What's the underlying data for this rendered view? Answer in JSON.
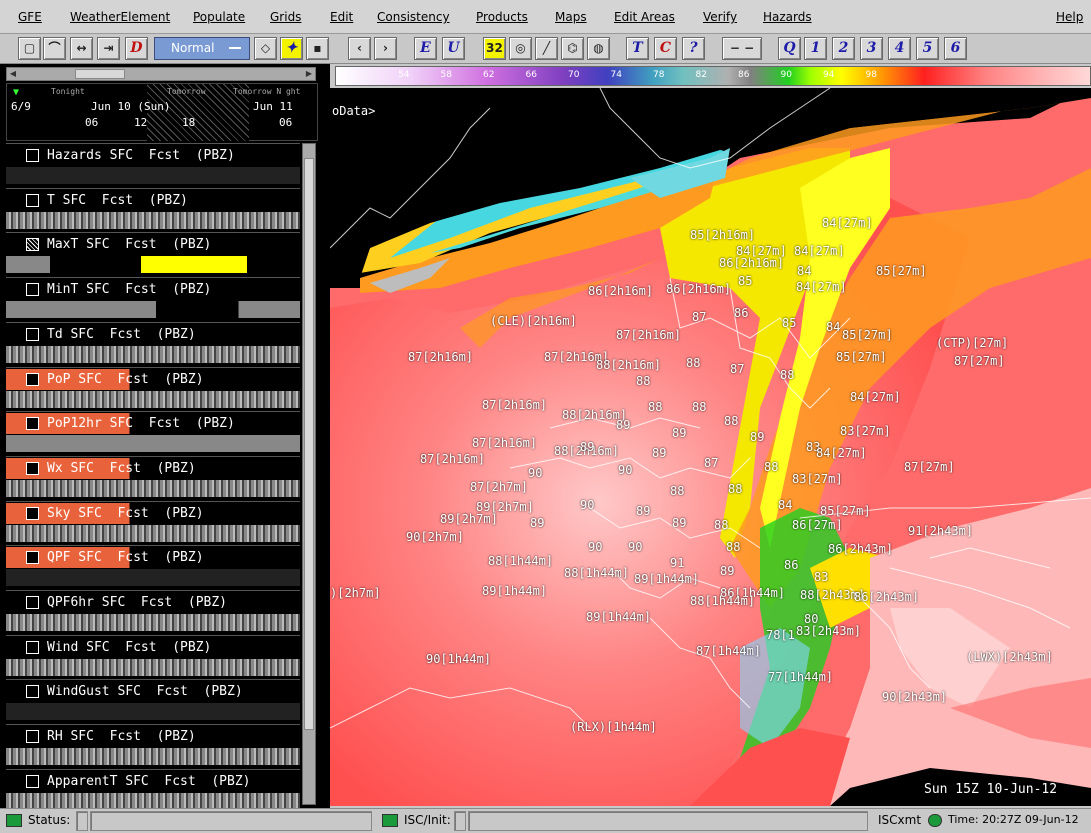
{
  "menu": [
    "GFE",
    "WeatherElement",
    "Populate",
    "Grids",
    "Edit",
    "Consistency",
    "Products",
    "Maps",
    "Edit Areas",
    "Verify",
    "Hazards"
  ],
  "help": "Help",
  "toolbar": {
    "mode": "Normal",
    "buttons": [
      "D",
      "E",
      "U",
      "T",
      "C",
      "?",
      "Q",
      "1",
      "2",
      "3",
      "4",
      "5",
      "6"
    ],
    "badge": "32"
  },
  "timeline": {
    "date": "6/9",
    "labels": [
      "Tonight",
      "Tomorrow",
      "Tomorrow N ght"
    ],
    "days": [
      "Jun 10 (Sun)",
      "Jun 11"
    ],
    "hours": [
      "06",
      "12",
      "18",
      "06"
    ]
  },
  "grids": [
    {
      "label": "Hazards SFC  Fcst  (PBZ)",
      "hl": false
    },
    {
      "label": "T SFC  Fcst  (PBZ)",
      "hl": false
    },
    {
      "label": "MaxT SFC  Fcst  (PBZ)",
      "hl": false,
      "hatch": true
    },
    {
      "label": "MinT SFC  Fcst  (PBZ)",
      "hl": false
    },
    {
      "label": "Td SFC  Fcst  (PBZ)",
      "hl": false
    },
    {
      "label": "PoP SFC  Fcst  (PBZ)",
      "hl": true
    },
    {
      "label": "PoP12hr SFC  Fcst  (PBZ)",
      "hl": true
    },
    {
      "label": "Wx SFC  Fcst  (PBZ)",
      "hl": true
    },
    {
      "label": "Sky SFC  Fcst  (PBZ)",
      "hl": true
    },
    {
      "label": "QPF SFC  Fcst  (PBZ)",
      "hl": true
    },
    {
      "label": "QPF6hr SFC  Fcst  (PBZ)",
      "hl": false
    },
    {
      "label": "Wind SFC  Fcst  (PBZ)",
      "hl": false
    },
    {
      "label": "WindGust SFC  Fcst  (PBZ)",
      "hl": false
    },
    {
      "label": "RH SFC  Fcst  (PBZ)",
      "hl": false
    },
    {
      "label": "ApparentT SFC  Fcst  (PBZ)",
      "hl": false
    }
  ],
  "colorbar": {
    "ticks": [
      "54",
      "58",
      "62",
      "66",
      "70",
      "74",
      "78",
      "82",
      "86",
      "90",
      "94",
      "98"
    ]
  },
  "map": {
    "nodata": "oData>",
    "timestamp": "Sun 15Z 10-Jun-12",
    "labels": [
      [
        "84[27m]",
        492,
        128
      ],
      [
        "85[2h16m]",
        360,
        140
      ],
      [
        "84[27m]",
        406,
        156
      ],
      [
        "84[27m]",
        464,
        156
      ],
      [
        "86[2h16m]",
        389,
        168
      ],
      [
        "85",
        408,
        186
      ],
      [
        "84",
        467,
        176
      ],
      [
        "84[27m]",
        466,
        192
      ],
      [
        "85[27m]",
        546,
        176
      ],
      [
        "86[2h16m]",
        258,
        196
      ],
      [
        "86[2h16m]",
        336,
        194
      ],
      [
        "(CLE)[2h16m]",
        160,
        226
      ],
      [
        "87",
        362,
        222
      ],
      [
        "86",
        404,
        218
      ],
      [
        "85",
        452,
        228
      ],
      [
        "84",
        496,
        232
      ],
      [
        "85[27m]",
        512,
        240
      ],
      [
        "(CTP)[27m]",
        606,
        248
      ],
      [
        "87[2h16m]",
        286,
        240
      ],
      [
        "87[2h16m]",
        78,
        262
      ],
      [
        "87[2h16m]",
        214,
        262
      ],
      [
        "88[2h16m]",
        266,
        270
      ],
      [
        "88",
        356,
        268
      ],
      [
        "87",
        400,
        274
      ],
      [
        "88",
        450,
        280
      ],
      [
        "85[27m]",
        506,
        262
      ],
      [
        "87[27m]",
        624,
        266
      ],
      [
        "88",
        306,
        286
      ],
      [
        "84[27m]",
        520,
        302
      ],
      [
        "87[2h16m]",
        152,
        310
      ],
      [
        "88[2h16m]",
        232,
        320
      ],
      [
        "88",
        318,
        312
      ],
      [
        "88",
        362,
        312
      ],
      [
        "88",
        394,
        326
      ],
      [
        "89",
        286,
        330
      ],
      [
        "89",
        342,
        338
      ],
      [
        "89",
        420,
        342
      ],
      [
        "83[27m]",
        510,
        336
      ],
      [
        "87[2h16m]",
        142,
        348
      ],
      [
        "88[2h16m]",
        224,
        356
      ],
      [
        "89",
        250,
        352
      ],
      [
        "89",
        322,
        358
      ],
      [
        "83",
        476,
        352
      ],
      [
        "84[27m]",
        486,
        358
      ],
      [
        "87[2h16m]",
        90,
        364
      ],
      [
        "87",
        374,
        368
      ],
      [
        "88",
        434,
        372
      ],
      [
        "87[27m]",
        574,
        372
      ],
      [
        "90",
        198,
        378
      ],
      [
        "90",
        288,
        375
      ],
      [
        "88",
        340,
        396
      ],
      [
        "88",
        398,
        394
      ],
      [
        "83[27m]",
        462,
        384
      ],
      [
        "87[2h7m]",
        140,
        392
      ],
      [
        "89[2h7m]",
        146,
        412
      ],
      [
        "90",
        250,
        410
      ],
      [
        "89",
        306,
        416
      ],
      [
        "84",
        448,
        410
      ],
      [
        "85[27m]",
        490,
        416
      ],
      [
        "89[2h7m]",
        110,
        424
      ],
      [
        "89",
        200,
        428
      ],
      [
        "89",
        342,
        428
      ],
      [
        "88",
        384,
        430
      ],
      [
        "86[27m]",
        462,
        430
      ],
      [
        "91[2h43m]",
        578,
        436
      ],
      [
        "90[2h7m]",
        76,
        442
      ],
      [
        "90",
        258,
        452
      ],
      [
        "90",
        298,
        452
      ],
      [
        "88",
        396,
        452
      ],
      [
        "86[2h43m]",
        498,
        454
      ],
      [
        "88[1h44m]",
        158,
        466
      ],
      [
        "88[1h44m]",
        234,
        478
      ],
      [
        "91",
        340,
        468
      ],
      [
        "89",
        390,
        476
      ],
      [
        "86",
        454,
        470
      ],
      [
        "83",
        484,
        482
      ],
      [
        "89[1h44m]",
        304,
        484
      ],
      [
        ")[2h7m]",
        0,
        498
      ],
      [
        "89[1h44m]",
        152,
        496
      ],
      [
        "86[1h44m]",
        390,
        498
      ],
      [
        "88[1h44m]",
        360,
        506
      ],
      [
        "88[2h43m]",
        470,
        500
      ],
      [
        "86[2h43m]",
        524,
        502
      ],
      [
        "89[1h44m]",
        256,
        522
      ],
      [
        "80",
        474,
        524
      ],
      [
        "83[2h43m]",
        466,
        536
      ],
      [
        "78[1",
        436,
        540
      ],
      [
        "87[1h44m]",
        366,
        556
      ],
      [
        "(LWX)[2h43m]",
        636,
        562
      ],
      [
        "90[1h44m]",
        96,
        564
      ],
      [
        "77[1h44m]",
        438,
        582
      ],
      [
        "90[2h43m]",
        552,
        602
      ],
      [
        "(RLX)[1h44m]",
        240,
        632
      ]
    ]
  },
  "status": {
    "status": "Status:",
    "isc": "ISC/Init:",
    "iscxmt": "ISCxmt",
    "time": "Time: 20:27Z 09-Jun-12"
  }
}
